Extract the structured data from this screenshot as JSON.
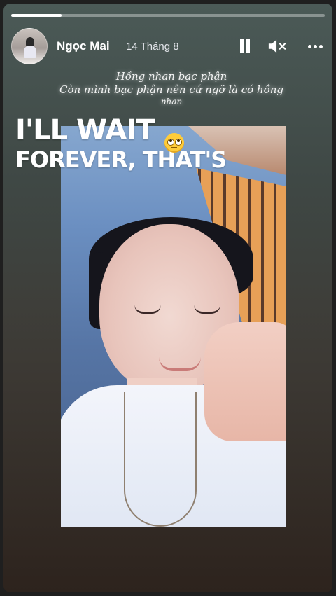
{
  "story": {
    "progress": 0.16,
    "author": "Ngọc Mai",
    "date": "14 Tháng 8",
    "controls": {
      "pause_icon": "pause-icon",
      "mute_icon": "speaker-muted-icon",
      "more_icon": "more-dots-icon"
    },
    "lyrics": {
      "line1": "Hồng nhan bạc phận",
      "line2": "Còn mình bạc phận nên cứ ngỡ là có hồng",
      "line3": "nhan"
    },
    "overlay": {
      "line1": "I'LL WAIT",
      "line2": "FOREVER, THAT'S",
      "emoji": "eye-roll-emoji"
    }
  }
}
